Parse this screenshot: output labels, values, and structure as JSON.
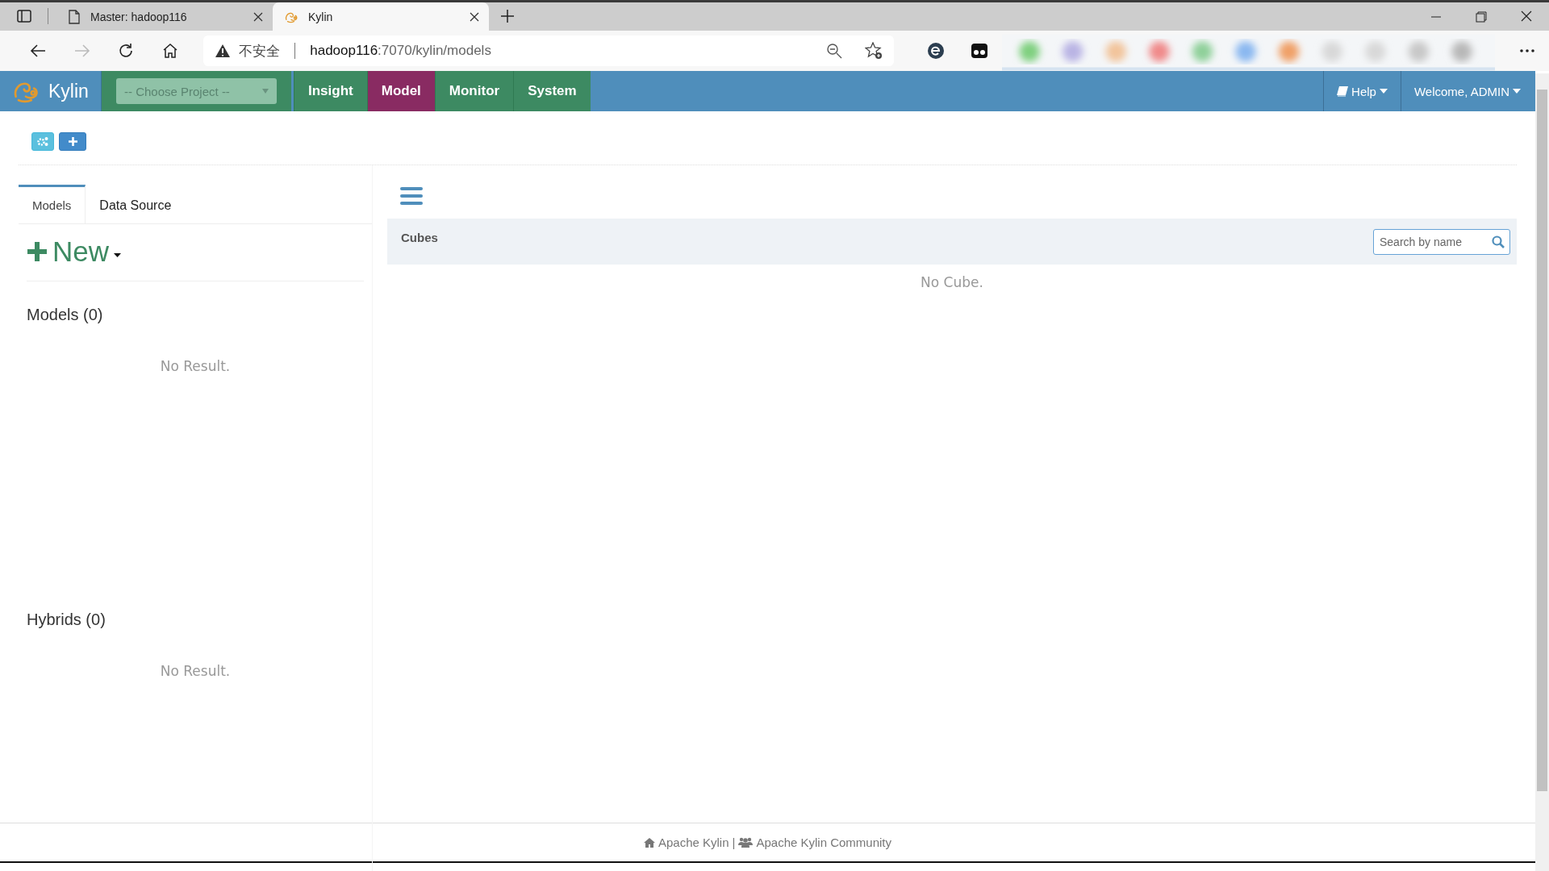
{
  "browser": {
    "tabs": [
      {
        "title": "Master: hadoop116",
        "kind": "page",
        "selected": false
      },
      {
        "title": "Kylin",
        "kind": "kylin",
        "selected": true
      }
    ],
    "address": {
      "security": "不安全",
      "host": "hadoop116",
      "path": ":7070/kylin/models"
    }
  },
  "navbar": {
    "brand": "Kylin",
    "project_select": {
      "placeholder": "-- Choose Project --"
    },
    "menu": [
      {
        "label": "Insight",
        "selected": false
      },
      {
        "label": "Model",
        "selected": true
      },
      {
        "label": "Monitor",
        "selected": false
      },
      {
        "label": "System",
        "selected": false
      }
    ],
    "help": "Help",
    "user": "Welcome, ADMIN"
  },
  "side_tabs": [
    {
      "label": "Models",
      "selected": true
    },
    {
      "label": "Data Source",
      "selected": false
    }
  ],
  "new_button": "New",
  "sections": [
    {
      "title": "Models (0)",
      "empty": "No Result."
    },
    {
      "title": "Hybrids (0)",
      "empty": "No Result."
    }
  ],
  "cubes": {
    "title": "Cubes",
    "search": {
      "placeholder": "Search by name"
    },
    "empty": "No Cube."
  },
  "footer": {
    "links": [
      "Apache Kylin",
      "Apache Kylin Community"
    ],
    "separator": "|"
  }
}
